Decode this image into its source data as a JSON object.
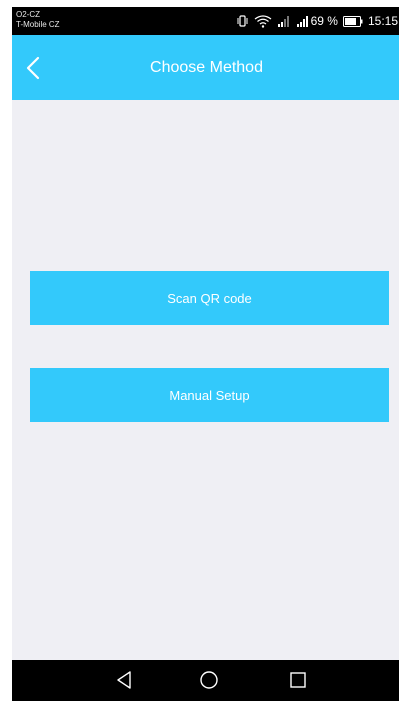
{
  "status_bar": {
    "carrier_1": "O2-CZ",
    "carrier_2": "T-Mobile CZ",
    "battery_percent": "69 %",
    "time": "15:15",
    "icons": [
      "vibrate-icon",
      "wifi-icon",
      "signal-1-icon",
      "signal-2-icon",
      "battery-icon"
    ]
  },
  "header": {
    "back_icon": "chevron-left-icon",
    "title": "Choose Method"
  },
  "methods": {
    "scan_label": "Scan QR code",
    "manual_label": "Manual Setup"
  },
  "nav_bar": {
    "icons": [
      "nav-back-icon",
      "nav-home-icon",
      "nav-recent-icon"
    ]
  },
  "colors": {
    "accent": "#33c9fb",
    "background": "#efeff4",
    "status_bar": "#000000",
    "text_on_accent": "#ffffff"
  }
}
